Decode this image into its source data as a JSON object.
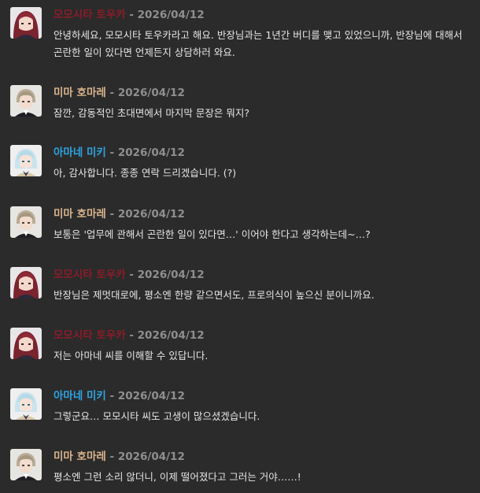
{
  "colors": {
    "background": "#2b2b2b",
    "momoshita": "#8a1c2a",
    "mima": "#d9b38c",
    "amane": "#2ea3e0",
    "date": "#8f8f8f",
    "text": "#e6e6e6"
  },
  "messages": [
    {
      "author": "모모시타 토우카",
      "color_key": "momoshita",
      "avatar": "momoshita-avatar",
      "separator": " - ",
      "date": "2026/04/12",
      "text": "안녕하세요, 모모시타 토우카라고 해요. 반장님과는 1년간 버디를 맺고 있었으니까, 반장님에 대해서 곤란한 일이 있다면 언제든지 상담하러 와요."
    },
    {
      "author": "미마 호마레",
      "color_key": "mima",
      "avatar": "mima-avatar",
      "separator": " - ",
      "date": "2026/04/12",
      "text": "잠깐, 감동적인 초대면에서 마지막 문장은 뭐지?"
    },
    {
      "author": "아마네 미키",
      "color_key": "amane",
      "avatar": "amane-avatar",
      "separator": " - ",
      "date": "2026/04/12",
      "text": "아, 감사합니다. 종종 연락 드리겠습니다. (?)"
    },
    {
      "author": "미마 호마레",
      "color_key": "mima",
      "avatar": "mima-avatar",
      "separator": " - ",
      "date": "2026/04/12",
      "text": "보통은 '업무에 관해서 곤란한 일이 있다면…' 이어야 한다고 생각하는데~…?"
    },
    {
      "author": "모모시타 토우카",
      "color_key": "momoshita",
      "avatar": "momoshita-avatar",
      "separator": " - ",
      "date": "2026/04/12",
      "text": "반장님은 제멋대로에, 평소엔 한량 같으면서도, 프로의식이 높으신 분이니까요."
    },
    {
      "author": "모모시타 토우카",
      "color_key": "momoshita",
      "avatar": "momoshita-avatar",
      "separator": " - ",
      "date": "2026/04/12",
      "text": "저는 아마네 씨를 이해할 수 있답니다."
    },
    {
      "author": "아마네 미키",
      "color_key": "amane",
      "avatar": "amane-avatar",
      "separator": " - ",
      "date": "2026/04/12",
      "text": "그렇군요… 모모시타 씨도 고생이 많으셨겠습니다."
    },
    {
      "author": "미마 호마레",
      "color_key": "mima",
      "avatar": "mima-avatar",
      "separator": " - ",
      "date": "2026/04/12",
      "text": "평소엔 그런 소리 않더니, 이제 떨어졌다고 그러는 거야……!"
    }
  ]
}
